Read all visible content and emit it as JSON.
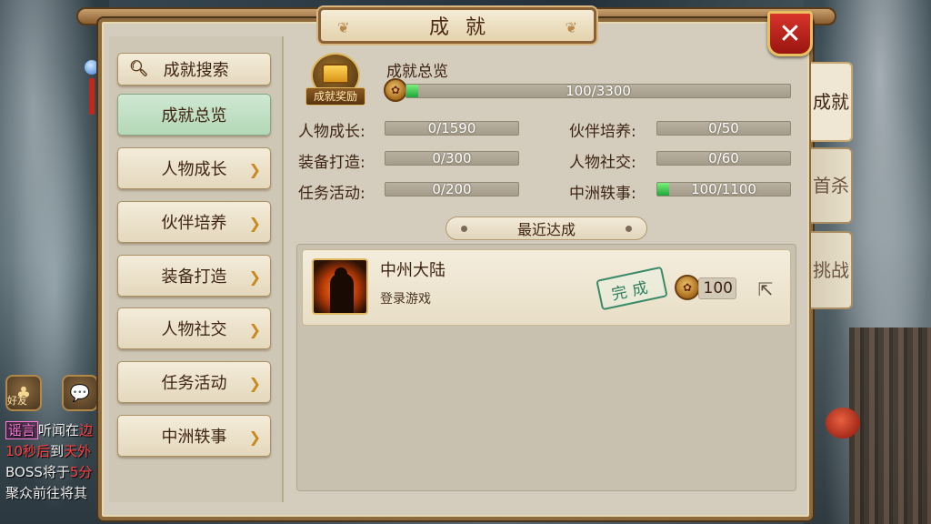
{
  "dialog": {
    "title": "成就",
    "close_label": "✕"
  },
  "menu": {
    "search_label": "成就搜索",
    "items": [
      {
        "label": "成就总览",
        "active": true
      },
      {
        "label": "人物成长"
      },
      {
        "label": "伙伴培养"
      },
      {
        "label": "装备打造"
      },
      {
        "label": "人物社交"
      },
      {
        "label": "任务活动"
      },
      {
        "label": "中洲轶事"
      }
    ]
  },
  "side_tabs": [
    {
      "label": "成就",
      "active": true
    },
    {
      "label": "首杀"
    },
    {
      "label": "挑战"
    }
  ],
  "overview": {
    "badge_label": "成就奖励",
    "title": "成就总览",
    "total": {
      "text": "100/3300",
      "progress": 0.0303
    },
    "stats": [
      {
        "label": "人物成长:",
        "value": "0/1590",
        "progress": 0
      },
      {
        "label": "伙伴培养:",
        "value": "0/50",
        "progress": 0
      },
      {
        "label": "装备打造:",
        "value": "0/300",
        "progress": 0
      },
      {
        "label": "人物社交:",
        "value": "0/60",
        "progress": 0
      },
      {
        "label": "任务活动:",
        "value": "0/200",
        "progress": 0
      },
      {
        "label": "中洲轶事:",
        "value": "100/1100",
        "progress": 0.0909
      }
    ]
  },
  "recent": {
    "title": "最近达成",
    "items": [
      {
        "name": "中州大陆",
        "desc": "登录游戏",
        "status": "完成",
        "reward": "100"
      }
    ]
  },
  "chat": {
    "friend_label": "好友",
    "lines": [
      {
        "tag": "谣言",
        "text": "听闻在",
        "extra": "边"
      },
      {
        "text_red": "10秒后",
        "text": "到",
        "extra": "天外"
      },
      {
        "text": "BOSS将于",
        "text_gold": "5分"
      },
      {
        "text": "聚众前往将其"
      }
    ]
  },
  "colors": {
    "accent_green": "#1aa83a",
    "close_red": "#d8342a",
    "stamp_green": "#2f7d5e",
    "frame_brown": "#8c6a3c"
  }
}
